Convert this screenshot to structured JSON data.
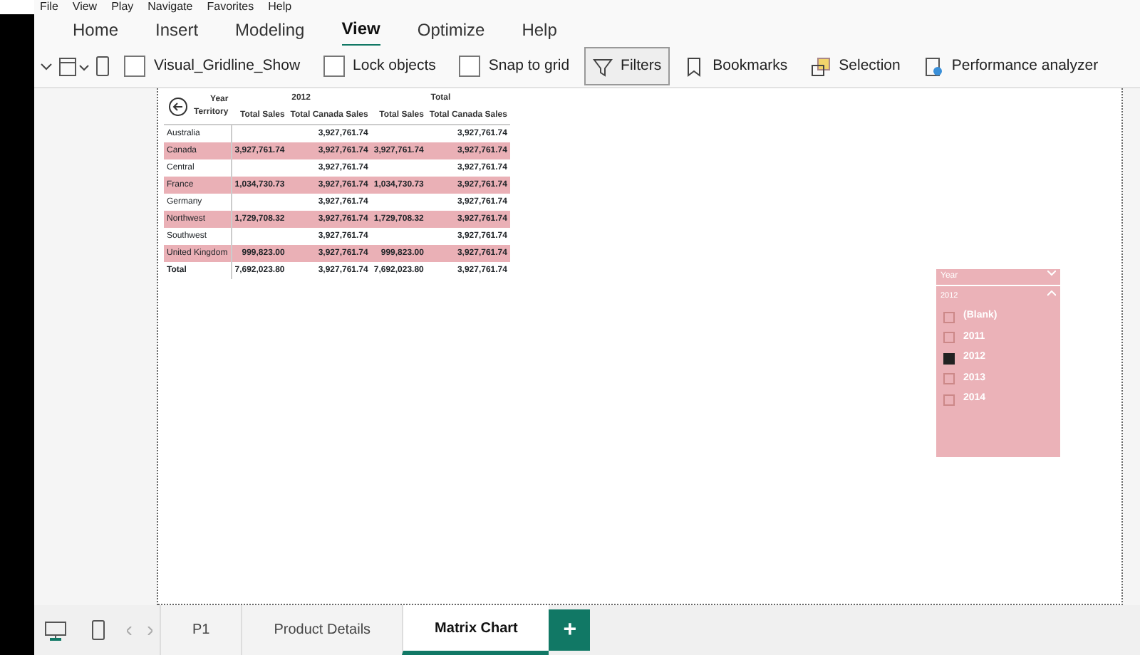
{
  "menu_bar": [
    "File",
    "View",
    "Play",
    "Navigate",
    "Favorites",
    "Help"
  ],
  "ribbon_tabs": [
    {
      "label": "Home",
      "selected": false
    },
    {
      "label": "Insert",
      "selected": false
    },
    {
      "label": "Modeling",
      "selected": false
    },
    {
      "label": "View",
      "selected": true
    },
    {
      "label": "Optimize",
      "selected": false
    },
    {
      "label": "Help",
      "selected": false
    }
  ],
  "toolbar": [
    {
      "kind": "checkbox",
      "label": "Visual_Gridline_Show",
      "checked": false
    },
    {
      "kind": "checkbox",
      "label": "Lock objects",
      "checked": false
    },
    {
      "kind": "checkbox",
      "label": "Snap to grid",
      "checked": false
    },
    {
      "kind": "filters",
      "label": "Filters",
      "selected": true
    },
    {
      "kind": "bookmarks",
      "label": "Bookmarks"
    },
    {
      "kind": "selection",
      "label": "Selection"
    },
    {
      "kind": "performance",
      "label": "Performance analyzer"
    }
  ],
  "matrix": {
    "corner": [
      "Year",
      "Territory"
    ],
    "column_groups": [
      "2012",
      "Total"
    ],
    "columns": [
      "Total Sales",
      "Total Canada Sales",
      "Total Sales",
      "Total Canada Sales"
    ],
    "rows": [
      {
        "territory": "Australia",
        "highlighted": false,
        "canada_sales_2012": "3,927,761.74",
        "canada_sales_total": "3,927,761.74"
      },
      {
        "territory": "Canada",
        "highlighted": true,
        "sales_2012": "3,927,761.74",
        "canada_sales_2012": "3,927,761.74",
        "sales_total": "3,927,761.74",
        "canada_sales_total": "3,927,761.74"
      },
      {
        "territory": "Central",
        "highlighted": false,
        "canada_sales_2012": "3,927,761.74",
        "canada_sales_total": "3,927,761.74"
      },
      {
        "territory": "France",
        "highlighted": true,
        "sales_2012": "1,034,730.73",
        "canada_sales_2012": "3,927,761.74",
        "sales_total": "1,034,730.73",
        "canada_sales_total": "3,927,761.74"
      },
      {
        "territory": "Germany",
        "highlighted": false,
        "canada_sales_2012": "3,927,761.74",
        "canada_sales_total": "3,927,761.74"
      },
      {
        "territory": "Northwest",
        "highlighted": true,
        "sales_2012": "1,729,708.32",
        "canada_sales_2012": "3,927,761.74",
        "sales_total": "1,729,708.32",
        "canada_sales_total": "3,927,761.74"
      },
      {
        "territory": "Southwest",
        "highlighted": false,
        "canada_sales_2012": "3,927,761.74",
        "canada_sales_total": "3,927,761.74"
      },
      {
        "territory": "United Kingdom",
        "highlighted": true,
        "sales_2012": "999,823.00",
        "canada_sales_2012": "3,927,761.74",
        "sales_total": "999,823.00",
        "canada_sales_total": "3,927,761.74"
      }
    ],
    "total": {
      "territory": "Total",
      "sales_2012": "7,692,023.80",
      "canada_sales_2012": "3,927,761.74",
      "sales_total": "7,692,023.80",
      "canada_sales_total": "3,927,761.74"
    }
  },
  "slicer": {
    "title": "Year",
    "group": "2012",
    "items": [
      {
        "label": "(Blank)",
        "checked": false
      },
      {
        "label": "2011",
        "checked": false
      },
      {
        "label": "2012",
        "checked": true
      },
      {
        "label": "2013",
        "checked": false
      },
      {
        "label": "2014",
        "checked": false
      }
    ]
  },
  "page_tabs": [
    {
      "label": "P1",
      "selected": false
    },
    {
      "label": "Product Details",
      "selected": false
    },
    {
      "label": "Matrix Chart",
      "selected": true
    }
  ],
  "add_page_button": "+"
}
